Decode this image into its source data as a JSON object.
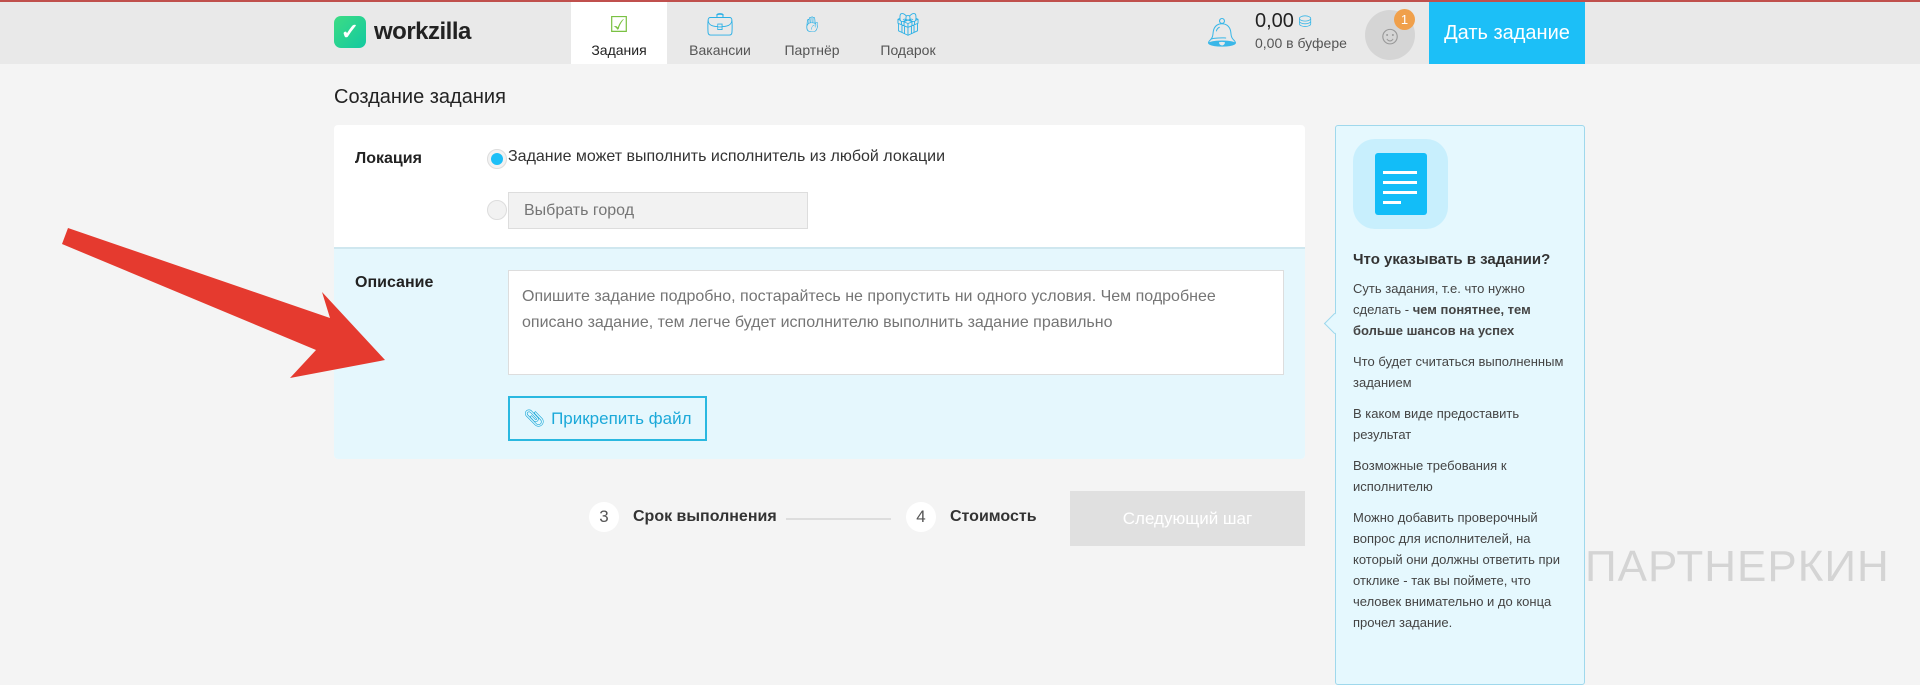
{
  "header": {
    "logo": "workzilla",
    "tabs": [
      {
        "label": "Задания",
        "icon": "check-square-icon",
        "active": true
      },
      {
        "label": "Вакансии",
        "icon": "briefcase-icon"
      },
      {
        "label": "Партнёр",
        "icon": "handshake-icon"
      },
      {
        "label": "Подарок",
        "icon": "gift-icon"
      }
    ],
    "balance": "0,00",
    "buffer": "0,00 в буфере",
    "notifications_badge": "1",
    "give_task_label": "Дать задание"
  },
  "page": {
    "title": "Создание задания"
  },
  "form": {
    "location_label": "Локация",
    "location_any": "Задание может выполнить исполнитель из любой локации",
    "city_placeholder": "Выбрать город",
    "description_label": "Описание",
    "description_placeholder": "Опишите задание подробно, постарайтесь не пропустить ни одного условия. Чем подробнее описано задание, тем легче будет исполнителю выполнить задание правильно",
    "attach_label": "Прикрепить файл"
  },
  "steps": [
    {
      "num": "3",
      "label": "Срок выполнения"
    },
    {
      "num": "4",
      "label": "Стоимость"
    }
  ],
  "next_label": "Следующий шаг",
  "sidebar": {
    "title": "Что указывать в задании?",
    "tip1_prefix": "Суть задания, т.е. что нужно сделать - ",
    "tip1_bold": "чем понятнее, тем больше шансов на успех",
    "tips": [
      "Что будет считаться выполненным заданием",
      "В каком виде предоставить результат",
      "Возможные требования к исполнителю",
      "Можно добавить проверочный вопрос для исполнителей, на который они должны ответить при отклике - так вы поймете, что человек внимательно и до конца прочел задание."
    ]
  },
  "watermark": "ПАРТНЕРКИН",
  "colors": {
    "accent": "#1cbff7",
    "arrow": "#e53a2f"
  }
}
